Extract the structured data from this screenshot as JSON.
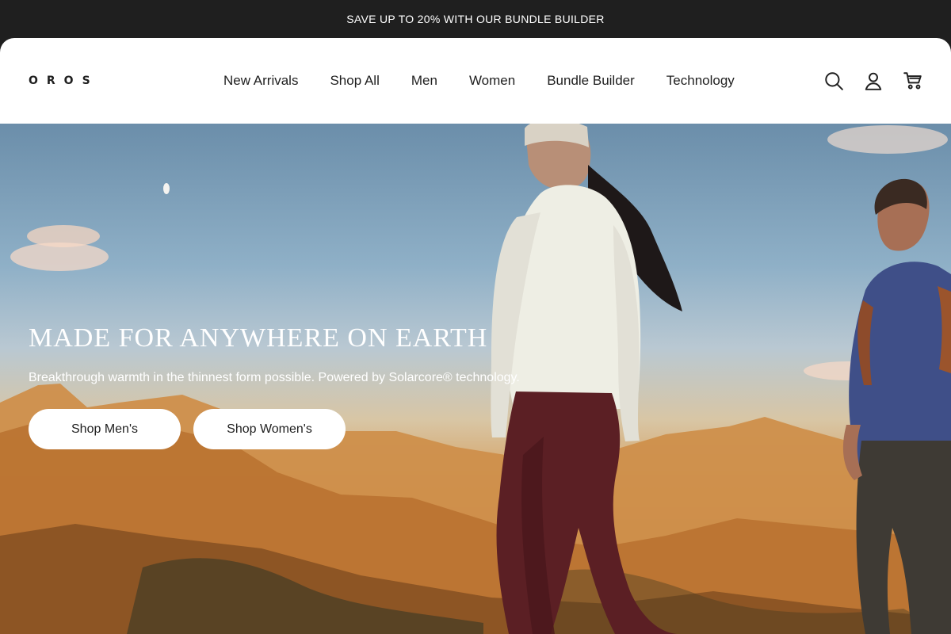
{
  "announcement": {
    "text": "SAVE UP TO 20% WITH OUR BUNDLE BUILDER"
  },
  "header": {
    "logo_text": "OROS",
    "nav": [
      {
        "label": "New Arrivals"
      },
      {
        "label": "Shop All"
      },
      {
        "label": "Men"
      },
      {
        "label": "Women"
      },
      {
        "label": "Bundle Builder"
      },
      {
        "label": "Technology"
      }
    ],
    "icons": [
      {
        "name": "search-icon"
      },
      {
        "name": "account-icon"
      },
      {
        "name": "cart-icon"
      }
    ]
  },
  "hero": {
    "title": "MADE FOR ANYWHERE ON EARTH",
    "subtitle": "Breakthrough warmth in the thinnest form possible. Powered by Solarcore® technology.",
    "buttons": [
      {
        "label": "Shop Men's"
      },
      {
        "label": "Shop Women's"
      }
    ]
  },
  "colors": {
    "dark": "#1f1f1f",
    "white": "#ffffff",
    "sky": "#8fb0c7",
    "mountain_gold": "#d59b58",
    "legging_maroon": "#5b1f24",
    "jacket_blue": "#3f4f88"
  }
}
